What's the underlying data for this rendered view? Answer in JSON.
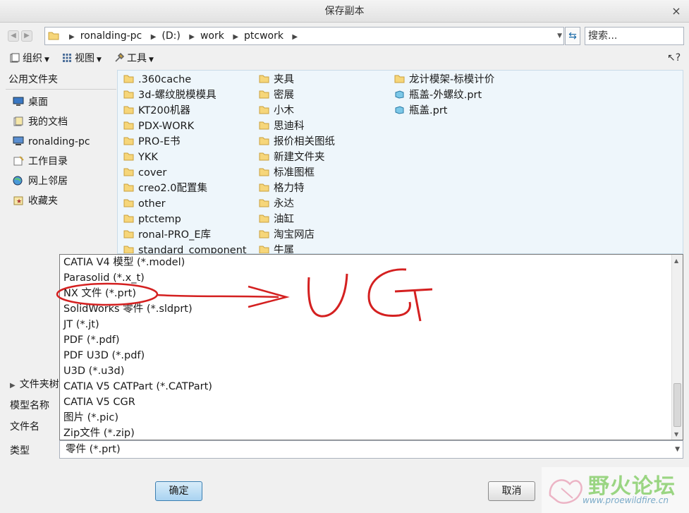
{
  "window": {
    "title": "保存副本",
    "close_glyph": "×"
  },
  "address": {
    "crumbs": [
      "ronalding-pc",
      "(D:)",
      "work",
      "ptcwork"
    ],
    "search_placeholder": "搜索..."
  },
  "toolbar": {
    "organize": "组织",
    "view": "视图",
    "tools": "工具"
  },
  "sidebar": {
    "header": "公用文件夹",
    "items": [
      {
        "label": "桌面",
        "icon": "desktop-icon"
      },
      {
        "label": "我的文档",
        "icon": "documents-icon"
      },
      {
        "label": "ronalding-pc",
        "icon": "computer-icon"
      },
      {
        "label": "工作目录",
        "icon": "working-directory-icon"
      },
      {
        "label": "网上邻居",
        "icon": "network-icon"
      },
      {
        "label": "收藏夹",
        "icon": "favorites-icon"
      }
    ]
  },
  "files": {
    "col1": [
      ".360cache",
      "3d-螺纹脱模模具",
      "KT200机器",
      "PDX-WORK",
      "PRO-E书",
      "YKK",
      "cover",
      "creo2.0配置集",
      "other",
      "ptctemp",
      "ronal-PRO_E库",
      "standard_component"
    ],
    "col2": [
      "夹具",
      "密展",
      "小木",
      "思迪科",
      "报价相关图纸",
      "新建文件夹",
      "标准图框",
      "格力特",
      "永达",
      "油缸",
      "淘宝网店",
      "牛属"
    ],
    "col3": [
      {
        "name": "龙计模架-标模计价",
        "type": "folder"
      },
      {
        "name": "瓶盖-外螺纹.prt",
        "type": "part"
      },
      {
        "name": "瓶盖.prt",
        "type": "part"
      }
    ]
  },
  "type_options": [
    "CATIA V4 模型 (*.model)",
    "Parasolid (*.x_t)",
    "NX 文件 (*.prt)",
    "SolidWorks 零件 (*.sldprt)",
    "JT (*.jt)",
    "PDF (*.pdf)",
    "PDF U3D (*.pdf)",
    "U3D (*.u3d)",
    "CATIA V5 CATPart (*.CATPart)",
    "CATIA V5 CGR",
    "图片 (*.pic)",
    "Zip文件 (*.zip)"
  ],
  "form": {
    "folder_tree_label": "文件夹树",
    "model_name_label": "模型名称",
    "file_name_label": "文件名",
    "type_label": "类型",
    "type_value": "零件 (*.prt)"
  },
  "buttons": {
    "ok": "确定",
    "cancel": "取消"
  },
  "annotation": {
    "handwritten_text": "UG",
    "color": "#d42020"
  },
  "watermark": {
    "title": "野火论坛",
    "url": "www.proewildfire.cn"
  }
}
